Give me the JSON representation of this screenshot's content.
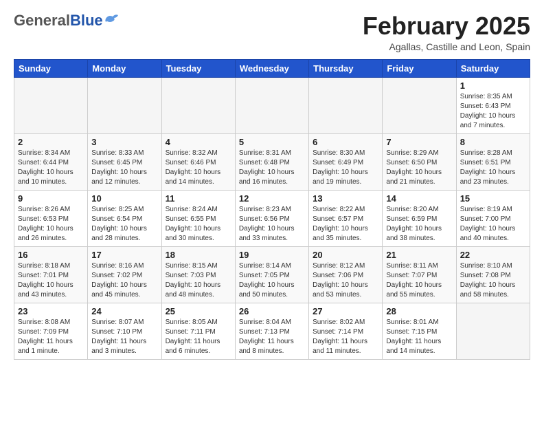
{
  "header": {
    "logo_general": "General",
    "logo_blue": "Blue",
    "title": "February 2025",
    "subtitle": "Agallas, Castille and Leon, Spain"
  },
  "weekdays": [
    "Sunday",
    "Monday",
    "Tuesday",
    "Wednesday",
    "Thursday",
    "Friday",
    "Saturday"
  ],
  "weeks": [
    [
      {
        "day": "",
        "info": ""
      },
      {
        "day": "",
        "info": ""
      },
      {
        "day": "",
        "info": ""
      },
      {
        "day": "",
        "info": ""
      },
      {
        "day": "",
        "info": ""
      },
      {
        "day": "",
        "info": ""
      },
      {
        "day": "1",
        "info": "Sunrise: 8:35 AM\nSunset: 6:43 PM\nDaylight: 10 hours and 7 minutes."
      }
    ],
    [
      {
        "day": "2",
        "info": "Sunrise: 8:34 AM\nSunset: 6:44 PM\nDaylight: 10 hours and 10 minutes."
      },
      {
        "day": "3",
        "info": "Sunrise: 8:33 AM\nSunset: 6:45 PM\nDaylight: 10 hours and 12 minutes."
      },
      {
        "day": "4",
        "info": "Sunrise: 8:32 AM\nSunset: 6:46 PM\nDaylight: 10 hours and 14 minutes."
      },
      {
        "day": "5",
        "info": "Sunrise: 8:31 AM\nSunset: 6:48 PM\nDaylight: 10 hours and 16 minutes."
      },
      {
        "day": "6",
        "info": "Sunrise: 8:30 AM\nSunset: 6:49 PM\nDaylight: 10 hours and 19 minutes."
      },
      {
        "day": "7",
        "info": "Sunrise: 8:29 AM\nSunset: 6:50 PM\nDaylight: 10 hours and 21 minutes."
      },
      {
        "day": "8",
        "info": "Sunrise: 8:28 AM\nSunset: 6:51 PM\nDaylight: 10 hours and 23 minutes."
      }
    ],
    [
      {
        "day": "9",
        "info": "Sunrise: 8:26 AM\nSunset: 6:53 PM\nDaylight: 10 hours and 26 minutes."
      },
      {
        "day": "10",
        "info": "Sunrise: 8:25 AM\nSunset: 6:54 PM\nDaylight: 10 hours and 28 minutes."
      },
      {
        "day": "11",
        "info": "Sunrise: 8:24 AM\nSunset: 6:55 PM\nDaylight: 10 hours and 30 minutes."
      },
      {
        "day": "12",
        "info": "Sunrise: 8:23 AM\nSunset: 6:56 PM\nDaylight: 10 hours and 33 minutes."
      },
      {
        "day": "13",
        "info": "Sunrise: 8:22 AM\nSunset: 6:57 PM\nDaylight: 10 hours and 35 minutes."
      },
      {
        "day": "14",
        "info": "Sunrise: 8:20 AM\nSunset: 6:59 PM\nDaylight: 10 hours and 38 minutes."
      },
      {
        "day": "15",
        "info": "Sunrise: 8:19 AM\nSunset: 7:00 PM\nDaylight: 10 hours and 40 minutes."
      }
    ],
    [
      {
        "day": "16",
        "info": "Sunrise: 8:18 AM\nSunset: 7:01 PM\nDaylight: 10 hours and 43 minutes."
      },
      {
        "day": "17",
        "info": "Sunrise: 8:16 AM\nSunset: 7:02 PM\nDaylight: 10 hours and 45 minutes."
      },
      {
        "day": "18",
        "info": "Sunrise: 8:15 AM\nSunset: 7:03 PM\nDaylight: 10 hours and 48 minutes."
      },
      {
        "day": "19",
        "info": "Sunrise: 8:14 AM\nSunset: 7:05 PM\nDaylight: 10 hours and 50 minutes."
      },
      {
        "day": "20",
        "info": "Sunrise: 8:12 AM\nSunset: 7:06 PM\nDaylight: 10 hours and 53 minutes."
      },
      {
        "day": "21",
        "info": "Sunrise: 8:11 AM\nSunset: 7:07 PM\nDaylight: 10 hours and 55 minutes."
      },
      {
        "day": "22",
        "info": "Sunrise: 8:10 AM\nSunset: 7:08 PM\nDaylight: 10 hours and 58 minutes."
      }
    ],
    [
      {
        "day": "23",
        "info": "Sunrise: 8:08 AM\nSunset: 7:09 PM\nDaylight: 11 hours and 1 minute."
      },
      {
        "day": "24",
        "info": "Sunrise: 8:07 AM\nSunset: 7:10 PM\nDaylight: 11 hours and 3 minutes."
      },
      {
        "day": "25",
        "info": "Sunrise: 8:05 AM\nSunset: 7:11 PM\nDaylight: 11 hours and 6 minutes."
      },
      {
        "day": "26",
        "info": "Sunrise: 8:04 AM\nSunset: 7:13 PM\nDaylight: 11 hours and 8 minutes."
      },
      {
        "day": "27",
        "info": "Sunrise: 8:02 AM\nSunset: 7:14 PM\nDaylight: 11 hours and 11 minutes."
      },
      {
        "day": "28",
        "info": "Sunrise: 8:01 AM\nSunset: 7:15 PM\nDaylight: 11 hours and 14 minutes."
      },
      {
        "day": "",
        "info": ""
      }
    ]
  ]
}
